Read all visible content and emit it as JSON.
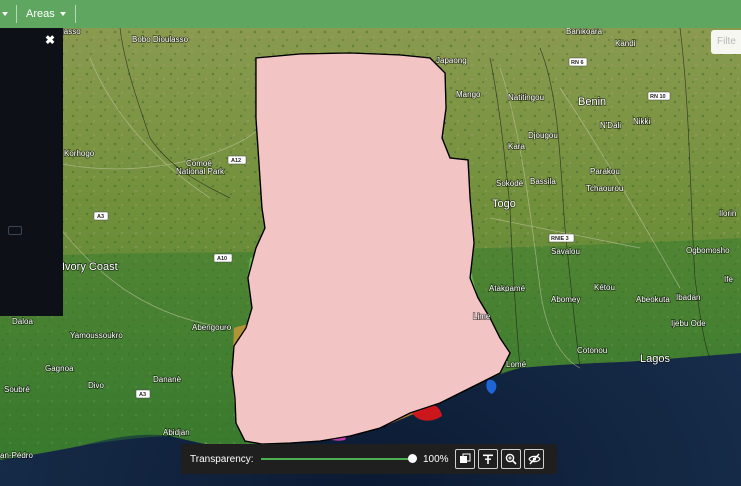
{
  "topbar": {
    "areas_label": "Areas"
  },
  "filter": {
    "placeholder": "Filte"
  },
  "transparency": {
    "label": "Transparency:",
    "value": 100,
    "value_text": "100%"
  },
  "toolbar_icons": [
    "layers-icon",
    "compare-icon",
    "zoom-in-icon",
    "hide-icon"
  ],
  "colors": {
    "topbar": "#5fa760",
    "accent": "#4caf50",
    "water": "#1e66d8",
    "boundary": "#111111"
  },
  "labels": {
    "bobo_dioulasso": "Bobo Dioulasso",
    "korhogo": "Korhogo",
    "comoe": "Comoé",
    "national_park": "National Park",
    "ivory_coast": "Ivory Coast",
    "daloa": "Daloa",
    "yamoussoukro": "Yamoussoukro",
    "gagnoa": "Gagnoa",
    "soubre": "Soubré",
    "divo": "Divo",
    "danane": "Dananè",
    "abengourou": "Abengouro",
    "abidjan": "Abidjan",
    "san_pedro": "an-Pédro",
    "lasso": "lasso",
    "banikoara": "Banikoara",
    "kandi": "Kandi",
    "japaong": "Japaong",
    "mango": "Mango",
    "natitingou": "Natitingou",
    "benin": "Benin",
    "djougou": "Djougou",
    "ndali": "N'Dali",
    "nikki": "Nikki",
    "kara": "Kara",
    "parakou": "Parakou",
    "sokode": "Sokodé",
    "bassila": "Bassila",
    "tchaourou": "Tchaourou",
    "togo": "Togo",
    "ilorin": "Ilorin",
    "savalou": "Savalou",
    "ogbomosho": "Ogbomosho",
    "atakpame": "Atakpamé",
    "ketou": "Kétou",
    "ife": "Ife",
    "abomey": "Abomey",
    "abeokuta": "Abeokuta",
    "ibadan": "Ibadan",
    "lome": "Lomé",
    "ijebu_ode": "Ijebu Ode",
    "cotonou": "Cotonou",
    "lagos": "Lagos",
    "lime": "Lime"
  },
  "roads": {
    "a12": "A12",
    "a3_north": "A3",
    "a10": "A10",
    "a3_south": "A3",
    "rn6": "RN 6",
    "rn10": "RN 10",
    "rnie3": "RNIE 3"
  }
}
